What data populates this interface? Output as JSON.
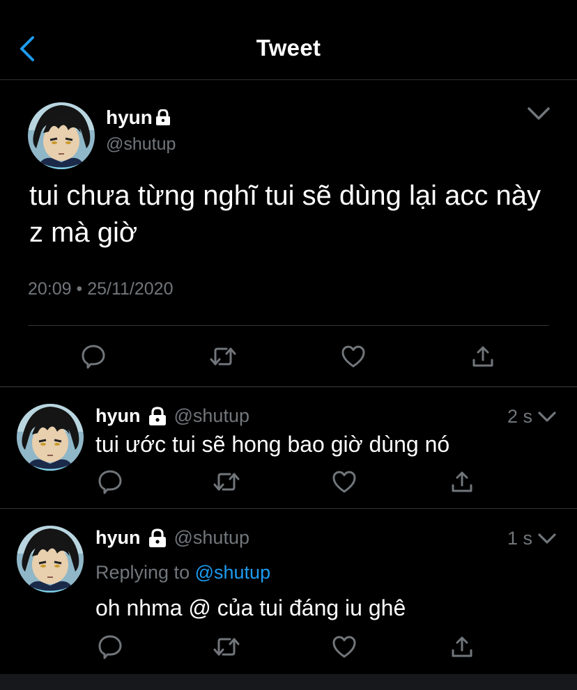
{
  "header": {
    "title": "Tweet",
    "back_icon": "chevron-left-icon",
    "accent": "#1d9bf0"
  },
  "main_tweet": {
    "name": "hyun",
    "handle": "@shutup",
    "text": "tui chưa từng nghĩ tui sẽ dùng lại acc này z mà giờ",
    "timestamp": "20:09 • 25/11/2020",
    "protected_icon": "lock-icon",
    "actions": [
      "reply-icon",
      "retweet-icon",
      "like-icon",
      "share-icon"
    ]
  },
  "replies": [
    {
      "name": "hyun",
      "handle": "@shutup",
      "time": "2 s",
      "text": "tui ước tui sẽ hong bao giờ dùng nó"
    },
    {
      "name": "hyun",
      "handle": "@shutup",
      "time": "1 s",
      "replying_prefix": "Replying to",
      "replying_to": "@shutup",
      "text": "oh nhma @ của tui đáng iu ghê"
    }
  ],
  "colors": {
    "background": "#000000",
    "text": "#ffffff",
    "secondary": "#71767b",
    "divider": "#2f3336",
    "link": "#1d9bf0"
  }
}
